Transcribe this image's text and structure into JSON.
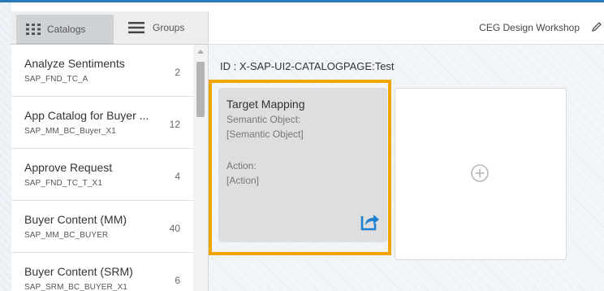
{
  "colors": {
    "accent": "#2a79b8",
    "highlight": "#f0a500",
    "tile": "#dedede"
  },
  "sidebar": {
    "tabs": [
      {
        "label": "Catalogs",
        "icon": "grid-icon",
        "selected": true
      },
      {
        "label": "Groups",
        "icon": "menu-icon",
        "selected": false
      }
    ],
    "items": [
      {
        "title": "Analyze Sentiments",
        "id": "SAP_FND_TC_A",
        "count": "2"
      },
      {
        "title": "App Catalog for Buyer ...",
        "id": "SAP_MM_BC_Buyer_X1",
        "count": "12"
      },
      {
        "title": "Approve Request",
        "id": "SAP_FND_TC_T_X1",
        "count": "4"
      },
      {
        "title": "Buyer Content (MM)",
        "id": "SAP_MM_BC_BUYER",
        "count": "40"
      },
      {
        "title": "Buyer Content (SRM)",
        "id": "SAP_SRM_BC_BUYER_X1",
        "count": "6"
      }
    ]
  },
  "header": {
    "title": "CEG Design Workshop",
    "edit_icon": "pencil-icon"
  },
  "main": {
    "page_id": "ID : X-SAP-UI2-CATALOGPAGE:Test",
    "tile": {
      "title": "Target Mapping",
      "semantic_object_label": "Semantic Object:",
      "semantic_object_value": "[Semantic Object]",
      "action_label": "Action:",
      "action_value": "[Action]",
      "icon": "share-icon"
    },
    "add_tile_icon": "add-icon"
  }
}
